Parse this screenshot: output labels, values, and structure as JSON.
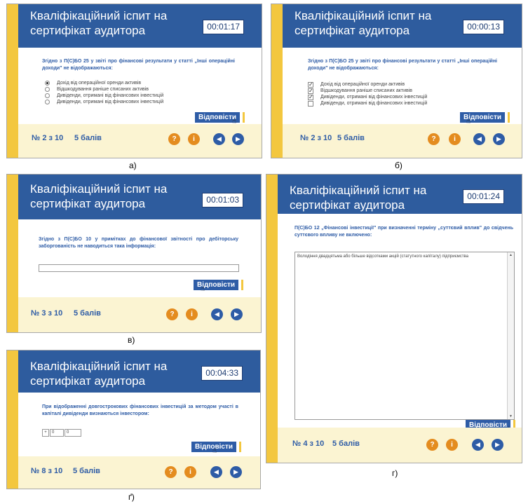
{
  "title": "Кваліфікаційний іспит на сертифікат аудитора",
  "answer_label": "Відповісти",
  "help_label": "?",
  "info_label": "i",
  "panels": {
    "a": {
      "caption": "а)",
      "timer": "00:01:17",
      "question": "Згідно з П(С)БО 25 у звіті про фінансові результати у статті „Інші операційні доходи\" не відображаються:",
      "options": [
        "Дохід від операційної оренди активів",
        "Відшкодування раніше списаних активів",
        "Дивіденди, отримані від фінансових інвестицій",
        "Дивіденди, отримані від фінансових інвестицій"
      ],
      "selected": 0,
      "number": "№ 2 з 10",
      "points": "5 балів"
    },
    "b": {
      "caption": "б)",
      "timer": "00:00:13",
      "question": "Згідно з П(С)БО 25 у звіті про фінансові результати у статті „Інші операційні доходи\" не відображаються:",
      "options": [
        "Дохід від операційної оренди активів",
        "Відшкодування раніше списаних активів",
        "Дивіденди, отримані від фінансових інвестицій",
        "Дивіденди, отримані від фінансових інвестицій"
      ],
      "checked": [
        true,
        true,
        true,
        false
      ],
      "number": "№ 2 з 10",
      "points": "5 балів"
    },
    "v": {
      "caption": "в)",
      "timer": "00:01:03",
      "question": "Згідно з П(С)БО 10 у примітках до фінансової звітності про дебіторську заборгованість не наводиться така інформація:",
      "input_value": "",
      "number": "№ 3 з 10",
      "points": "5 балів"
    },
    "g2": {
      "caption": "ґ)",
      "timer": "00:04:33",
      "question": "При відображенні довгострокових фінансових інвестицій за методом участі в капіталі дивіденди визнаються інвестором:",
      "sign": "+",
      "value1": "0",
      "value2": "0",
      "number": "№ 8 з 10",
      "points": "5 балів"
    },
    "g": {
      "caption": "г)",
      "timer": "00:01:24",
      "question": "П(С)БО 12 „Фінансові інвестиції\" при визначенні терміну „суттєвий вплив\" до свідчень суттєвого впливу не включено:",
      "textarea": "Володіння двадцятьма або більше відсотками акцій (статутного капіталу) підприємства",
      "number": "№ 4 з 10",
      "points": "5 балів"
    }
  },
  "colors": {
    "header": "#2e5c9e",
    "accent": "#f3c73f",
    "text_blue": "#2e5ca6",
    "orange": "#e48c1f"
  }
}
